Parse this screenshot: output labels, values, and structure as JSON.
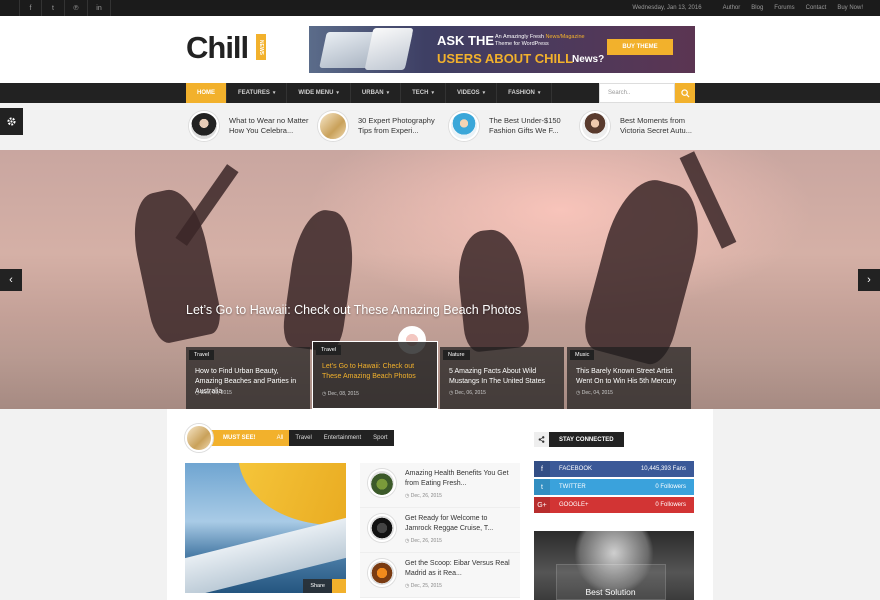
{
  "topbar": {
    "social_icons": [
      "facebook-icon",
      "tumblr-icon",
      "pinterest-icon",
      "linkedin-icon"
    ],
    "social_glyphs": [
      "f",
      "t",
      "℗",
      "in"
    ],
    "date": "Wednesday, Jan 13, 2016",
    "links": [
      "Author",
      "Blog",
      "Forums",
      "Contact",
      "Buy Now!"
    ]
  },
  "header": {
    "logo": "Chill",
    "logo_tag": "NEWS",
    "ad": {
      "line1": "ASK THE",
      "line1_small_pre": "An Amazingly Fresh ",
      "line1_small_hl": "News/Magazine",
      "line1_small_post": " Theme for WordPress",
      "line2": "USERS ABOUT CHILL",
      "line2_tail": "News?",
      "button": "BUY THEME"
    }
  },
  "nav": {
    "items": [
      {
        "label": "HOME",
        "active": true
      },
      {
        "label": "FEATURES"
      },
      {
        "label": "WIDE MENU"
      },
      {
        "label": "URBAN"
      },
      {
        "label": "TECH"
      },
      {
        "label": "VIDEOS"
      },
      {
        "label": "FASHION"
      }
    ],
    "search_placeholder": "Search.."
  },
  "ticker": [
    "What to Wear no Matter How You Celebra...",
    "30 Expert Photography Tips from Experi...",
    "The Best Under-$150 Fashion Gifts We F...",
    "Best Moments from Victoria Secret Autu..."
  ],
  "hero": {
    "title": "Let’s Go to Hawaii: Check out These Amazing Beach Photos",
    "cards": [
      {
        "cat": "Travel",
        "title": "How to Find Urban Beauty, Amazing Beaches and Parties in Australia",
        "date": "Dec, 09, 2015"
      },
      {
        "cat": "Travel",
        "title": "Let’s Go to Hawaii: Check out These Amazing Beach Photos",
        "date": "Dec, 08, 2015",
        "active": true
      },
      {
        "cat": "Nature",
        "title": "5 Amazing Facts About Wild Mustangs In The United States",
        "date": "Dec, 06, 2015"
      },
      {
        "cat": "Music",
        "title": "This Barely Known Street Artist Went On to Win His 5th Mercury",
        "date": "Dec, 04, 2015"
      }
    ]
  },
  "must_see": {
    "label": "MUST SEE!",
    "tabs": [
      "All",
      "Travel",
      "Entertainment",
      "Sport"
    ],
    "share_label": "Share",
    "list": [
      {
        "title": "Amazing Health Benefits You Get from Eating Fresh...",
        "date": "Dec, 26, 2015"
      },
      {
        "title": "Get Ready for Welcome to Jamrock Reggae Cruise, T...",
        "date": "Dec, 26, 2015"
      },
      {
        "title": "Get the Scoop: Eibar Versus Real Madrid as it Rea...",
        "date": "Dec, 25, 2015"
      }
    ]
  },
  "stay_connected": {
    "label": "STAY CONNECTED",
    "networks": [
      {
        "name": "FACEBOOK",
        "count": "10,445,393 Fans",
        "color": "#3b5998",
        "icon": "f"
      },
      {
        "name": "TWITTER",
        "count": "0 Followers",
        "color": "#3aa2dc",
        "icon": "t"
      },
      {
        "name": "GOOGLE+",
        "count": "0 Followers",
        "color": "#d23434",
        "icon": "G+"
      }
    ]
  },
  "ad_bottom": "Best Solution",
  "colors": {
    "accent": "#f2b12c",
    "dark": "#222222"
  }
}
